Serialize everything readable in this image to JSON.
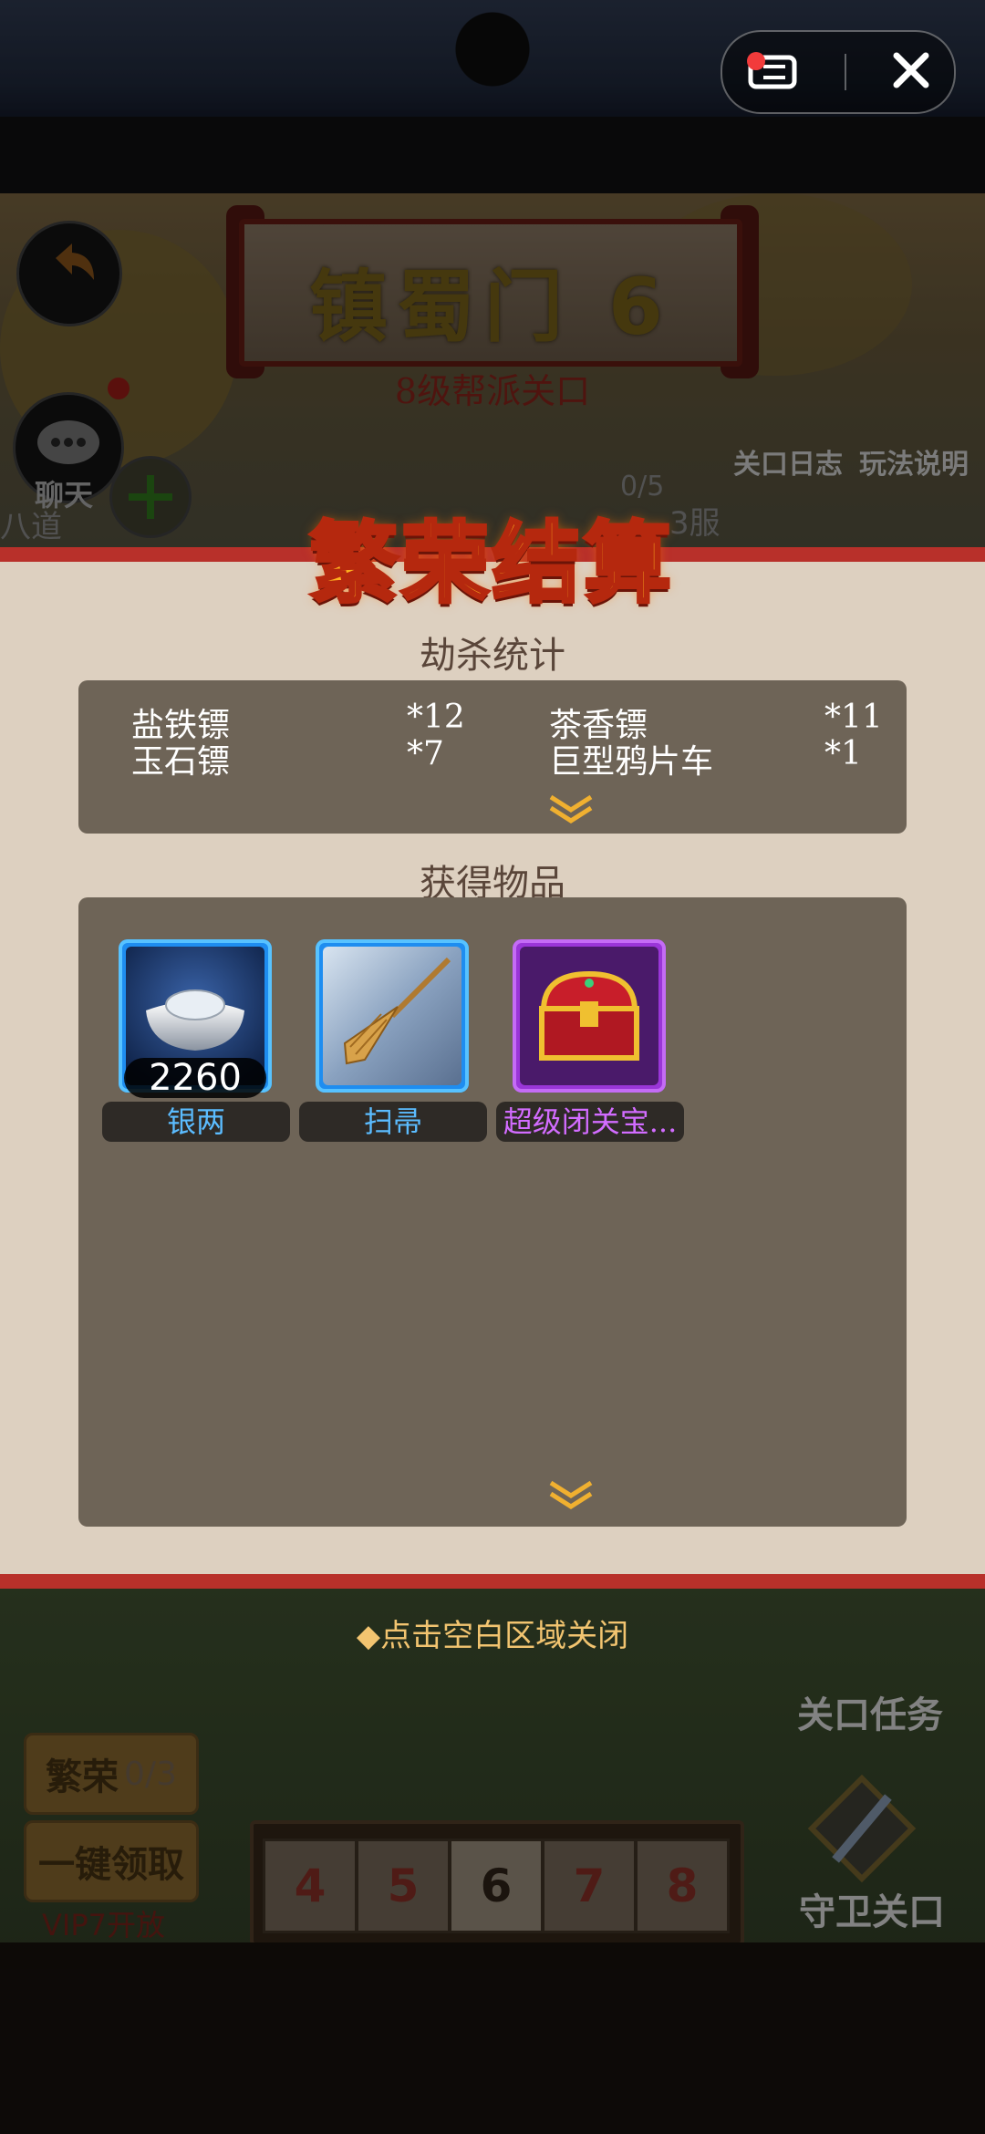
{
  "background": {
    "stage_title": "镇蜀门 6",
    "stage_subtitle": "8级帮派关口",
    "chat_label": "聊天",
    "left_edge_text": "八道",
    "progress": "0/5",
    "server": "3服",
    "log_button": "关口日志",
    "rules_button": "玩法说明",
    "task_button": "关口任务",
    "guard_button": "守卫关口",
    "prosperity_label": "繁荣",
    "prosperity_count": "0/3",
    "claim_all_button": "一键领取",
    "vip_unlock": "VIP7开放",
    "levels": [
      "4",
      "5",
      "6",
      "7",
      "8"
    ],
    "current_level": "6"
  },
  "capsule": {
    "menu_icon": "menu-icon",
    "close_icon": "close-icon"
  },
  "modal": {
    "title": "繁荣结算",
    "kill_stats": {
      "heading": "劫杀统计",
      "rows": [
        {
          "name": "盐铁镖",
          "count": "*12"
        },
        {
          "name": "茶香镖",
          "count": "*11"
        },
        {
          "name": "玉石镖",
          "count": "*7"
        },
        {
          "name": "巨型鸦片车",
          "count": "*1"
        }
      ]
    },
    "items": {
      "heading": "获得物品",
      "list": [
        {
          "label": "银两",
          "count": "2260",
          "rarity_color": "#5bbcff",
          "icon": "silver-ingot-icon"
        },
        {
          "label": "扫帚",
          "count": "",
          "rarity_color": "#5bbcff",
          "icon": "broom-icon"
        },
        {
          "label": "超级闭关宝...",
          "count": "",
          "rarity_color": "#d26cff",
          "icon": "treasure-chest-icon"
        }
      ]
    },
    "close_hint": "◆点击空白区域关闭"
  },
  "colors": {
    "modal_bg": "#ddd0c0",
    "panel_bg": "#6e6457",
    "accent_red": "#b8302a",
    "title_gold": "#ffb21f",
    "hint": "#f2c470"
  }
}
